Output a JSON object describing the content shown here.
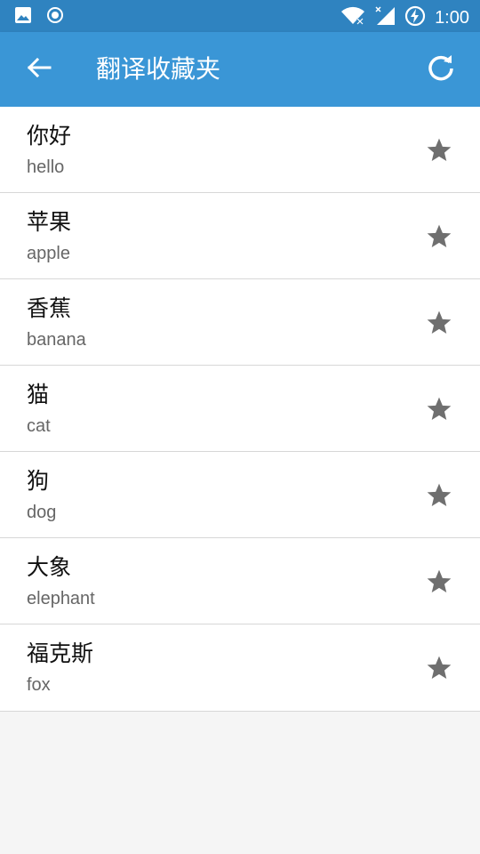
{
  "status_bar": {
    "time": "1:00",
    "icons": [
      "image-icon",
      "record-icon",
      "wifi-icon",
      "signal-icon",
      "battery-charging-icon"
    ]
  },
  "app_bar": {
    "title": "翻译收藏夹",
    "back_icon": "arrow-back-icon",
    "refresh_icon": "refresh-icon"
  },
  "favorites": [
    {
      "word": "你好",
      "translation": "hello"
    },
    {
      "word": "苹果",
      "translation": "apple"
    },
    {
      "word": "香蕉",
      "translation": "banana"
    },
    {
      "word": "猫",
      "translation": "cat"
    },
    {
      "word": "狗",
      "translation": "dog"
    },
    {
      "word": "大象",
      "translation": "elephant"
    },
    {
      "word": "福克斯",
      "translation": "fox"
    }
  ],
  "colors": {
    "status_bar": "#2f83c0",
    "app_bar": "#3a96d6",
    "star": "#6f6f6f"
  }
}
